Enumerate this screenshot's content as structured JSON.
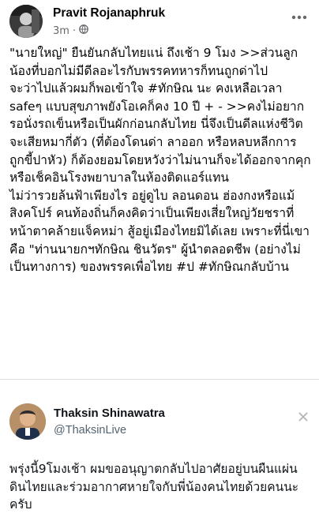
{
  "post": {
    "author": "Pravit Rojanaphruk",
    "time": "3m",
    "dot": "·",
    "body": "\"นายใหญ่\" ยืนยันกลับไทยแน่ ถึงเช้า 9 โมง >>ส่วนลูกน้องที่บอกไม่มีดีลอะไรกับพรรคทหารก็ทนถูกด่าไป\nจะว่าไปแล้วผมก็พอเข้าใจ #ทักษิณ นะ คงเหลือเวลา safeๆ แบบสุขภาพยังโอเคก็คง 10 ปี + - >>คงไม่อยากรอนั่งรถเข็นหรือเป็นผักก่อนกลับไทย นี่จึงเป็นดีลแห่งชีวิต จะเสียหมากี่ตัว (ที่ต้องโดนด่า ลาออก หรือหลบหลีกการถูกขี้ปาหัว) ก็ต้องยอมโดยหวังว่าไม่นานก็จะได้ออกจากคุกหรือเช็คอินโรงพยาบาลในห้องติดแอร์แทน\nไม่ว่ารวยล้นฟ้าเพียงไร อยู่ดูไบ ลอนดอน ฮ่องกงหรือแม้สิงคโปร์ คนท้องถิ่นก็คงคิดว่าเป็นเพียงเสี่ยใหญ่วัยชราที่หน้าตาคล้ายแจ็คหม่า สู้อยู่เมืองไทยมิได้เลย เพราะที่นี่เขาคือ \"ท่านนายกฯทักษิณ ชินวัตร\" ผู้นำตลอดชีพ (อย่างไม่เป็นทางการ) ของพรรคเพื่อไทย #ป #ทักษิณกลับบ้าน"
  },
  "quote": {
    "name": "Thaksin Shinawatra",
    "handle": "@ThaksinLive",
    "text": "พรุ่งนี้9โมงเช้า ผมขออนุญาตกลับไปอาศัยอยู่บนผืนแผ่นดินไทยและร่วมอากาศหายใจกับพี่น้องคนไทยด้วยคนนะครับ"
  },
  "icons": {
    "audience": "globe-icon",
    "more": "more-options-icon",
    "dismiss": "close-icon"
  },
  "colors": {
    "meta_gray": "#65676b",
    "handle_gray": "#536471"
  }
}
